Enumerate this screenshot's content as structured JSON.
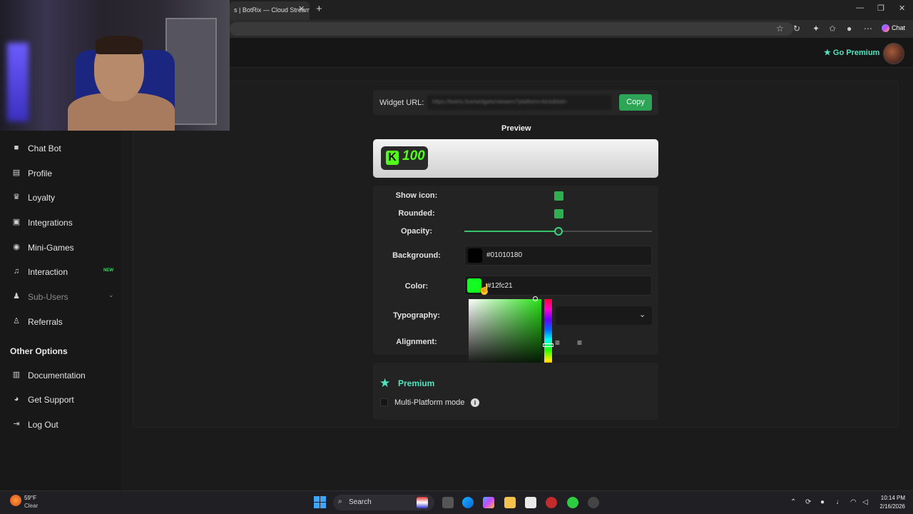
{
  "browser": {
    "tab_title": "s | BotRix — Cloud Streami",
    "tab_close": "✕",
    "new_tab": "+",
    "chat_label": "Chat"
  },
  "header": {
    "go_premium": "Go Premium"
  },
  "sidebar": {
    "items": [
      {
        "label": "Chat Bot"
      },
      {
        "label": "Profile"
      },
      {
        "label": "Loyalty"
      },
      {
        "label": "Integrations"
      },
      {
        "label": "Mini-Games"
      },
      {
        "label": "Interaction",
        "badge": "NEW"
      },
      {
        "label": "Sub-Users"
      },
      {
        "label": "Referrals"
      }
    ],
    "other_options_title": "Other Options",
    "other_items": [
      {
        "label": "Documentation"
      },
      {
        "label": "Get Support"
      },
      {
        "label": "Log Out"
      }
    ]
  },
  "widget": {
    "url_label": "Widget URL:",
    "url_value": "https://botrix.live/widgets/viewers?platform=kick&bid=",
    "copy_label": "Copy",
    "preview_label": "Preview",
    "preview_value": "100"
  },
  "settings": {
    "show_icon_label": "Show icon:",
    "show_icon": true,
    "rounded_label": "Rounded:",
    "rounded": true,
    "opacity_label": "Opacity:",
    "opacity": 0.5,
    "background_label": "Background:",
    "background_hex": "#01010180",
    "color_label": "Color:",
    "color_hex": "#12fc21",
    "typography_label": "Typography:",
    "alignment_label": "Alignment:"
  },
  "premium": {
    "title": "Premium",
    "multi_platform_label": "Multi-Platform mode",
    "multi_platform": false
  },
  "taskbar": {
    "temp": "59°F",
    "weather": "Clear",
    "search_label": "Search",
    "time": "10:14 PM",
    "date": "2/16/2026"
  },
  "colors": {
    "accent_green": "#2ea457",
    "premium_teal": "#4ee6c0",
    "picked_color": "#12fc21"
  }
}
